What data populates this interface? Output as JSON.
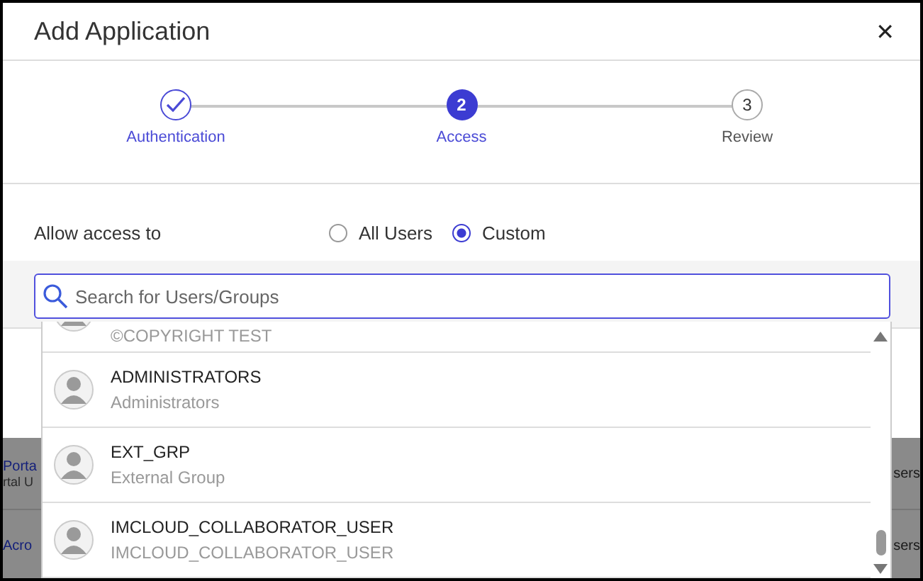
{
  "window": {
    "title": "Add Application",
    "close": "✕"
  },
  "steps": [
    {
      "label": "Authentication",
      "done": true,
      "selected": false
    },
    {
      "label": "Access",
      "number": "2",
      "done": false,
      "selected": true
    },
    {
      "label": "Review",
      "number": "3",
      "done": false,
      "selected": false
    }
  ],
  "access": {
    "label": "Allow access to",
    "options": [
      {
        "label": "All Users",
        "selected": false
      },
      {
        "label": "Custom",
        "selected": true
      }
    ]
  },
  "search": {
    "placeholder": "Search for Users/Groups"
  },
  "results": [
    {
      "subtitle": "©COPYRIGHT TEST",
      "partial": true
    },
    {
      "name": "ADMINISTRATORS",
      "subtitle": "Administrators"
    },
    {
      "name": "EXT_GRP",
      "subtitle": "External Group"
    },
    {
      "name": "IMCLOUD_COLLABORATOR_USER",
      "subtitle": "IMCLOUD_COLLABORATOR_USER"
    }
  ],
  "background_rows": [
    {
      "left": "Porta",
      "left_sub": "rtal U",
      "right": "sers"
    },
    {
      "left": "Acro",
      "right": "sers"
    }
  ]
}
